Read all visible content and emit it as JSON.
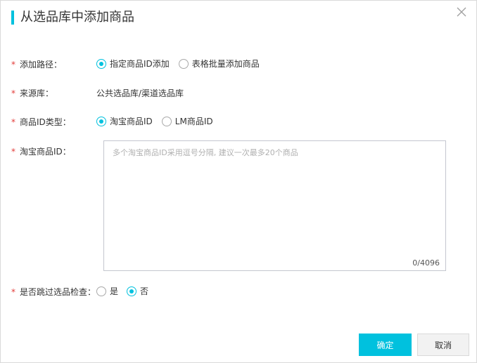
{
  "dialog": {
    "title": "从选品库中添加商品",
    "accent_color": "#00c1de",
    "close_icon": "close-icon"
  },
  "form": {
    "add_path": {
      "required_mark": "*",
      "label": "添加路径：",
      "options": [
        {
          "label": "指定商品ID添加",
          "checked": true
        },
        {
          "label": "表格批量添加商品",
          "checked": false
        }
      ]
    },
    "source": {
      "required_mark": "*",
      "label": "来源库：",
      "value": "公共选品库/渠道选品库"
    },
    "id_type": {
      "required_mark": "*",
      "label": "商品ID类型：",
      "options": [
        {
          "label": "淘宝商品ID",
          "checked": true
        },
        {
          "label": "LM商品ID",
          "checked": false
        }
      ]
    },
    "taobao_ids": {
      "required_mark": "*",
      "label": "淘宝商品ID：",
      "value": "",
      "placeholder": "多个淘宝商品ID采用逗号分隔, 建议一次最多20个商品",
      "counter": "0/4096"
    },
    "skip_check": {
      "required_mark": "*",
      "label": "是否跳过选品检查：",
      "options": [
        {
          "label": "是",
          "checked": false
        },
        {
          "label": "否",
          "checked": true
        }
      ]
    }
  },
  "footer": {
    "confirm_label": "确定",
    "cancel_label": "取消"
  }
}
